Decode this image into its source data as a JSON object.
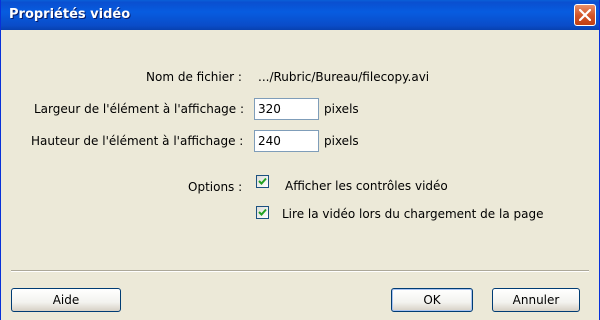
{
  "dialog": {
    "title": "Propriétés vidéo",
    "close_icon": "close-icon",
    "accent_color": "#0a4fd0",
    "close_color": "#d4562a"
  },
  "form": {
    "filename_label": "Nom de fichier :",
    "filename_value": ".../Rubric/Bureau/filecopy.avi",
    "width_label": "Largeur de l'élément à l'affichage :",
    "width_value": "320",
    "width_unit": "pixels",
    "height_label": "Hauteur de l'élément à l'affichage :",
    "height_value": "240",
    "height_unit": "pixels",
    "options_label": "Options :",
    "options": [
      {
        "label": "Afficher les contrôles vidéo",
        "checked": true
      },
      {
        "label": "Lire la vidéo lors du chargement de la page",
        "checked": true
      }
    ]
  },
  "buttons": {
    "help": "Aide",
    "ok": "OK",
    "cancel": "Annuler"
  }
}
